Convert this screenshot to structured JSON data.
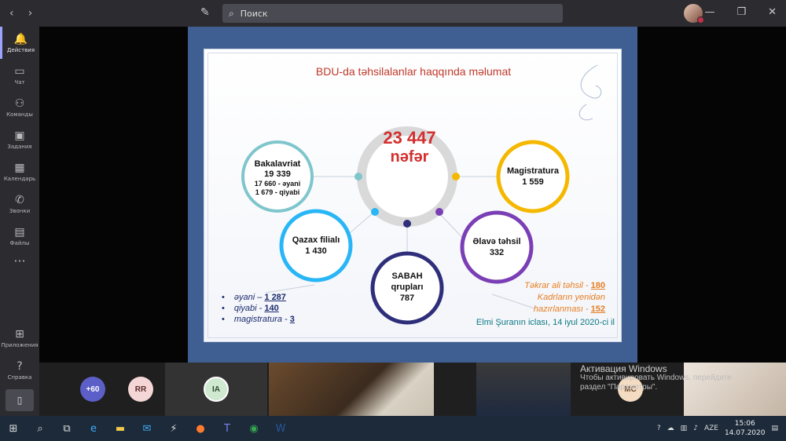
{
  "titlebar": {
    "search_placeholder": "Поиск"
  },
  "sidebar": {
    "items": [
      {
        "label": "Действия",
        "icon": "bell-icon"
      },
      {
        "label": "Чат",
        "icon": "chat-icon"
      },
      {
        "label": "Команды",
        "icon": "teams-icon"
      },
      {
        "label": "Задания",
        "icon": "assignments-icon"
      },
      {
        "label": "Календарь",
        "icon": "calendar-icon"
      },
      {
        "label": "Звонки",
        "icon": "phone-icon"
      },
      {
        "label": "Файлы",
        "icon": "files-icon"
      }
    ],
    "more": "···",
    "bottom": [
      {
        "label": "Приложения",
        "icon": "apps-icon"
      },
      {
        "label": "Справка",
        "icon": "help-icon"
      }
    ]
  },
  "slide": {
    "title": "BDU-da təhsilalanlar haqqında məlumat",
    "total_number": "23 447",
    "total_unit": "nəfər",
    "bakalavriat": {
      "name": "Bakalavriat",
      "count": "19 339",
      "line1": "17 660 - əyani",
      "line2": "1 679 - qiyabi"
    },
    "magistratura": {
      "name": "Magistratura",
      "count": "1 559"
    },
    "qazax": {
      "name": "Qazax filialı",
      "count": "1 430"
    },
    "sabah": {
      "name1": "SABAH",
      "name2": "qrupları",
      "count": "787"
    },
    "elave": {
      "name": "Əlavə təhsil",
      "count": "332"
    },
    "bullets": [
      {
        "text": "əyani – ",
        "value": "1 287"
      },
      {
        "text": "qiyabi - ",
        "value": "140"
      },
      {
        "text": "magistratura - ",
        "value": "3"
      }
    ],
    "extra": {
      "line1": "Təkrar ali təhsil - ",
      "value1": "180",
      "line2": "Kadrların yenidən",
      "line3": "hazırlanması - ",
      "value3": "152"
    },
    "footnote": "Elmi Şuranın iclası, 14 iyul 2020-ci il",
    "colors": {
      "bakalavriat": "#7fc6cc",
      "magistratura": "#f5b800",
      "qazax": "#29b6f6",
      "sabah": "#2e2e7a",
      "elave": "#7b3fb5",
      "center": "#d9d9d9"
    }
  },
  "participants": {
    "more_count": "+60",
    "initials": [
      "RR",
      "IA",
      "MC"
    ],
    "activation_title": "Активация Windows",
    "activation_line1": "Чтобы активировать Windows, перейдите",
    "activation_line2": "раздел \"Параметры\"."
  },
  "taskbar": {
    "lang": "AZE",
    "time": "15:06",
    "date": "14.07.2020"
  }
}
